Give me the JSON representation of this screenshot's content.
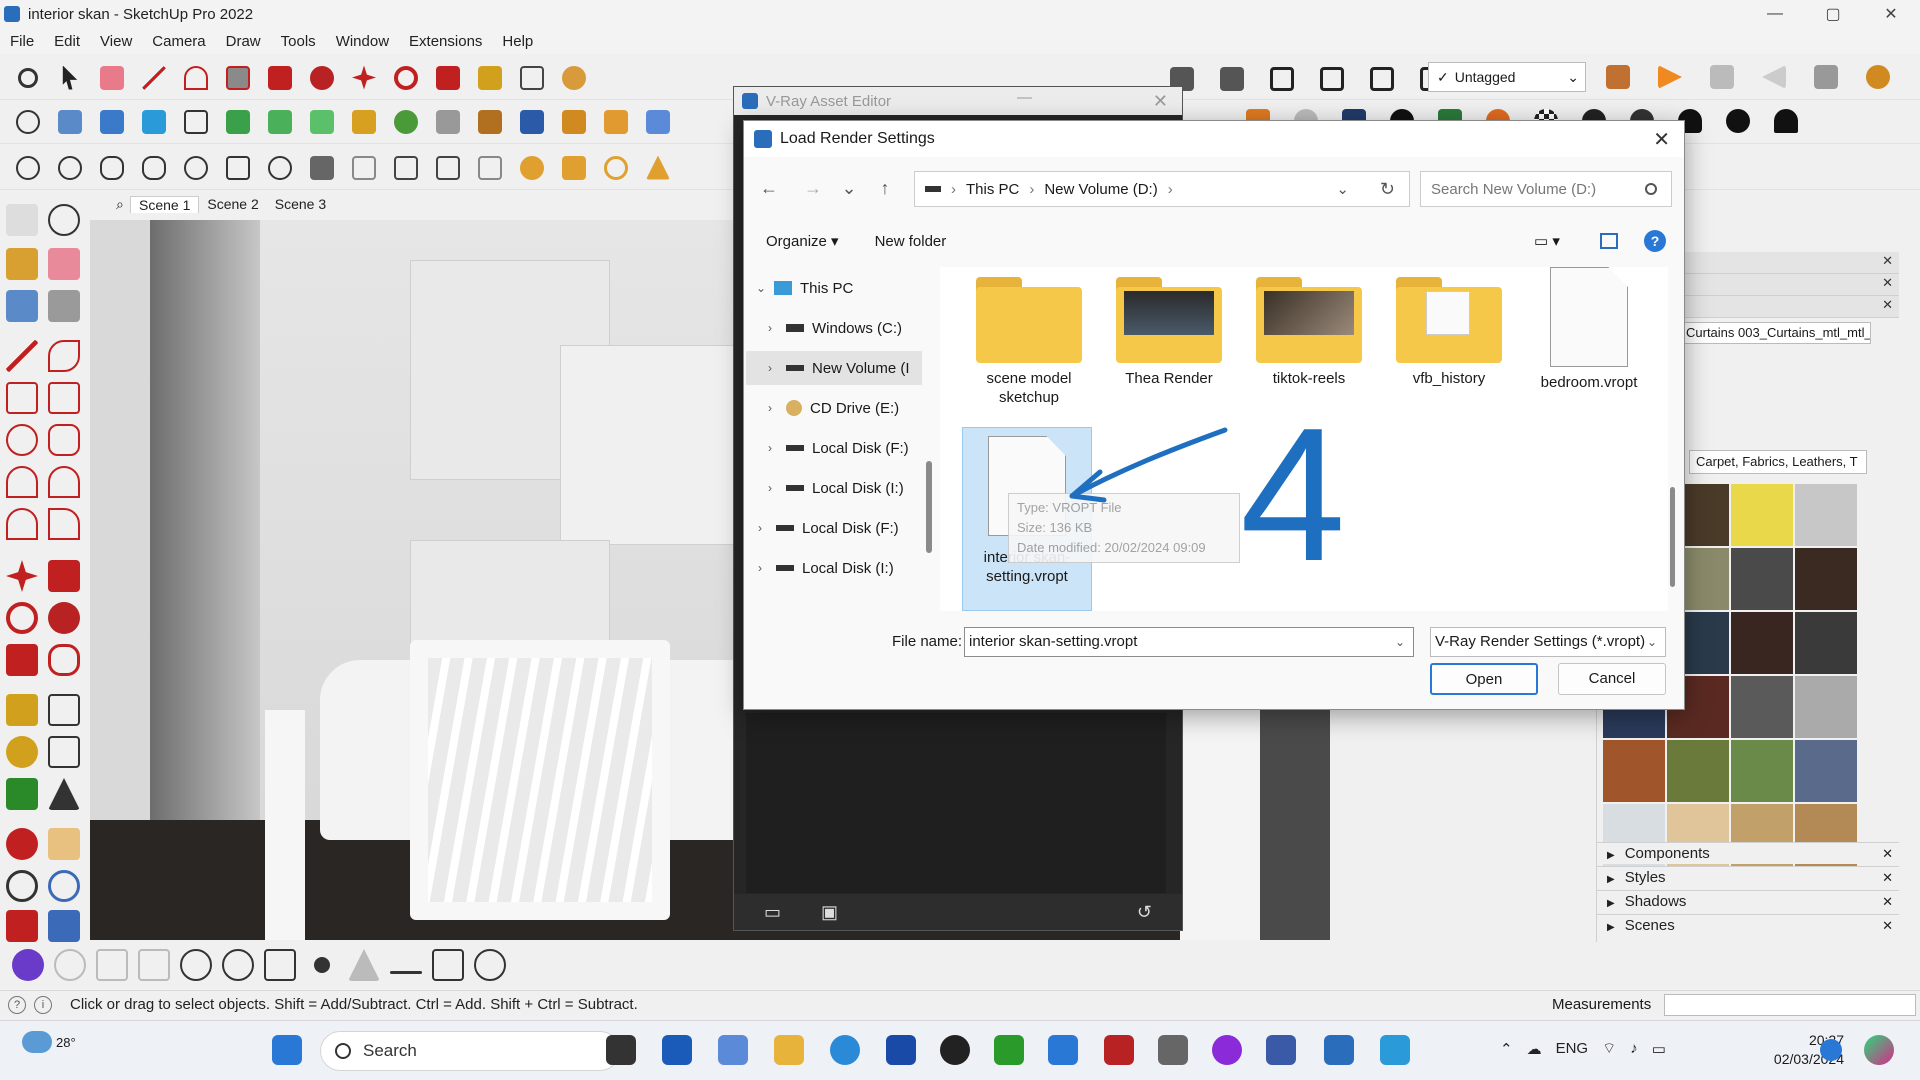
{
  "window": {
    "title": "interior skan - SketchUp Pro 2022",
    "controls": {
      "minimize": "—",
      "maximize": "▢",
      "close": "✕"
    }
  },
  "menu": [
    "File",
    "Edit",
    "View",
    "Camera",
    "Draw",
    "Tools",
    "Window",
    "Extensions",
    "Help"
  ],
  "tag_selector": {
    "value": "Untagged"
  },
  "scenes": [
    "Scene 1",
    "Scene 2",
    "Scene 3"
  ],
  "vray_editor": {
    "title": "V-Ray Asset Editor"
  },
  "tray": {
    "material_name": "Curtains 003_Curtains_mtl_mtl_",
    "material_category": "Carpet, Fabrics, Leathers, T",
    "sections": [
      "Components",
      "Styles",
      "Shadows",
      "Scenes"
    ],
    "swatch_colors": [
      "#8a8a8a",
      "#4a3a28",
      "#e8d84a",
      "#c7c7c7",
      "#7a5a3a",
      "#8a8a6a",
      "#4a4a4a",
      "#3a2a22",
      "#9a9a7a",
      "#2a3a4a",
      "#3a2620",
      "#3a3a3a",
      "#2a3a5a",
      "#5a2a22",
      "#5a5a5a",
      "#aaaaaa",
      "#a0562a",
      "#6a7a3a",
      "#6a8a4a",
      "#5a6a8a",
      "#d8dde2",
      "#e0c49a",
      "#c2a06a",
      "#b38a55"
    ]
  },
  "dialog": {
    "title": "Load Render Settings",
    "close": "✕",
    "nav": {
      "back": "←",
      "forward": "→",
      "recent": "⌄",
      "up": "↑"
    },
    "address": {
      "segments": [
        "This PC",
        "New Volume (D:)"
      ],
      "dropdown": "⌄",
      "refresh": "↻"
    },
    "search_placeholder": "Search New Volume (D:)",
    "commands": {
      "organize": "Organize ▾",
      "new_folder": "New folder",
      "help": "?"
    },
    "nav_pane": [
      {
        "label": "This PC",
        "expanded": true
      },
      {
        "label": "Windows (C:)"
      },
      {
        "label": "New Volume (I",
        "selected": true
      },
      {
        "label": "CD Drive (E:)"
      },
      {
        "label": "Local Disk (F:)"
      },
      {
        "label": "Local Disk (I:)"
      },
      {
        "label": "Local Disk (F:)"
      },
      {
        "label": "Local Disk (I:)"
      }
    ],
    "files": [
      {
        "name": "scene model sketchup",
        "kind": "folder"
      },
      {
        "name": "Thea Render",
        "kind": "folder-thumb"
      },
      {
        "name": "tiktok-reels",
        "kind": "folder-thumb"
      },
      {
        "name": "vfb_history",
        "kind": "folder-doc"
      },
      {
        "name": "bedroom.vropt",
        "kind": "file"
      },
      {
        "name": "interior skan-setting.vropt",
        "kind": "file",
        "selected": true
      }
    ],
    "tooltip": {
      "type": "Type: VROPT File",
      "size": "Size: 136 KB",
      "modified": "Date modified: 20/02/2024 09:09"
    },
    "file_name_label": "File name:",
    "file_name_value": "interior skan-setting.vropt",
    "filter": "V-Ray Render Settings (*.vropt)",
    "open_label": "Open",
    "cancel_label": "Cancel",
    "annotation": "4"
  },
  "status": {
    "message": "Click or drag to select objects. Shift = Add/Subtract. Ctrl = Add. Shift + Ctrl = Subtract.",
    "measurements_label": "Measurements"
  },
  "taskbar": {
    "weather": "28°",
    "search_label": "Search",
    "language": "ENG",
    "time": "20:27",
    "date": "02/03/2024"
  }
}
